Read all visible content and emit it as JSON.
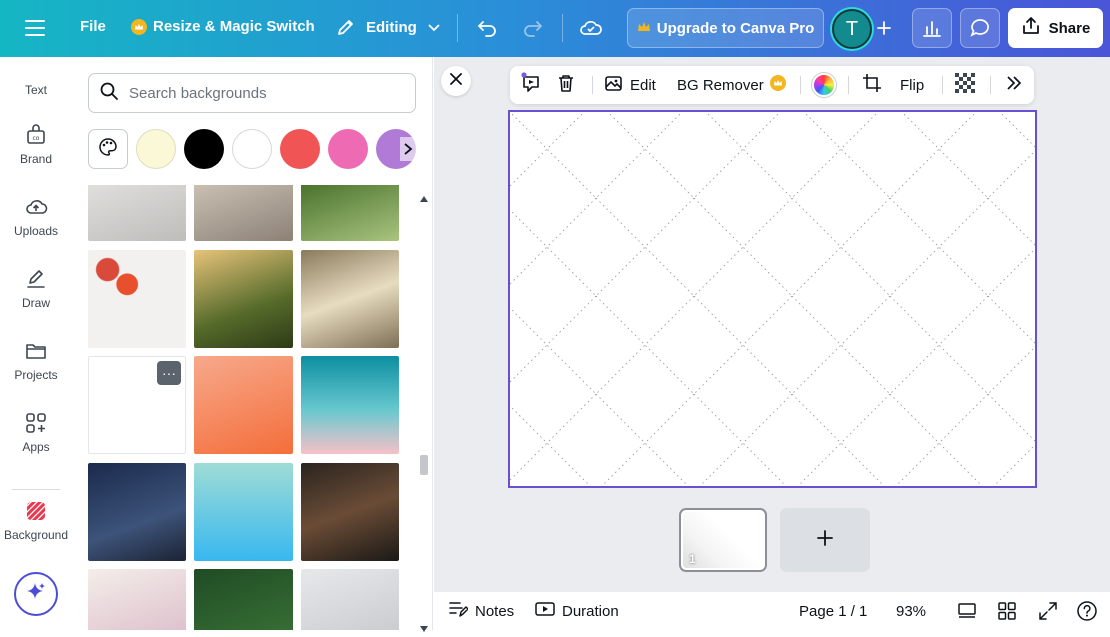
{
  "topbar": {
    "file_label": "File",
    "resize_label": "Resize & Magic Switch",
    "editing_label": "Editing",
    "upgrade_label": "Upgrade to Canva Pro",
    "avatar_initial": "T",
    "share_label": "Share"
  },
  "rail": {
    "items": [
      {
        "label": "Text",
        "icon": "text-icon"
      },
      {
        "label": "Brand",
        "icon": "brand-icon"
      },
      {
        "label": "Uploads",
        "icon": "cloud-upload-icon"
      },
      {
        "label": "Draw",
        "icon": "pen-icon"
      },
      {
        "label": "Projects",
        "icon": "folder-icon"
      },
      {
        "label": "Apps",
        "icon": "apps-grid-icon"
      },
      {
        "label": "Background",
        "icon": "background-stripes-icon"
      }
    ]
  },
  "panel": {
    "search_placeholder": "Search backgrounds",
    "swatches": [
      "#fbf8d8",
      "#000000",
      "#ffffff",
      "#f05454",
      "#ee6ab3",
      "#b07ad6"
    ],
    "thumbnails": [
      {
        "name": "grey-texture",
        "bg": "linear-gradient(160deg,#e3e2df,#bfbdba)"
      },
      {
        "name": "wooden-steps",
        "bg": "linear-gradient(160deg,#cfc6b9,#8d8176)"
      },
      {
        "name": "green-grass",
        "bg": "linear-gradient(160deg,#3f6a24,#a9c47f)"
      },
      {
        "name": "fruit-flatlay",
        "bg": "radial-gradient(circle at 40% 35%,#e8502d 0 12%,transparent 13%),radial-gradient(circle at 20% 20%,#d94a3a 0 10%,transparent 11%),#f3f1ef"
      },
      {
        "name": "sunset-grass",
        "bg": "linear-gradient(160deg,#e7c37a,#566b2a 60%,#2d3a17)"
      },
      {
        "name": "crystals",
        "bg": "linear-gradient(160deg,#8a7a5c,#e8dcc0 50%,#7d6f55)"
      },
      {
        "name": "white-pattern",
        "bg": "#ffffff",
        "has_more": true
      },
      {
        "name": "peach-gradient",
        "bg": "linear-gradient(160deg,#f7a98c,#f46e3a)"
      },
      {
        "name": "teal-sky",
        "bg": "linear-gradient(180deg,#0c8fa0,#68c8cf 55%,#f7c1c8)"
      },
      {
        "name": "night-sky",
        "bg": "linear-gradient(160deg,#1a2a4d,#3d5379 60%,#1c2334)"
      },
      {
        "name": "aqua-gradient",
        "bg": "linear-gradient(180deg,#9fdcd5,#38b8f0)"
      },
      {
        "name": "milky-way",
        "bg": "linear-gradient(160deg,#2a241f,#6a4c36 50%,#1c1916)"
      },
      {
        "name": "pink-flowers",
        "bg": "linear-gradient(160deg,#f3eee9,#d7b1c3)"
      },
      {
        "name": "forest-road",
        "bg": "linear-gradient(160deg,#1f4c25,#3f7a38)"
      },
      {
        "name": "snow-dunes",
        "bg": "linear-gradient(160deg,#e7e8ea,#bfc2c7)"
      }
    ],
    "more_symbol": "···"
  },
  "context_toolbar": {
    "edit_label": "Edit",
    "bg_remover_label": "BG Remover",
    "flip_label": "Flip"
  },
  "canvas": {
    "page_number": "1"
  },
  "footer": {
    "notes_label": "Notes",
    "duration_label": "Duration",
    "page_label": "Page 1 / 1",
    "zoom_label": "93%"
  },
  "colors": {
    "accent": "#6b4fd1",
    "canvas_border": "#6b4fd1",
    "crown": "#f2b620"
  }
}
